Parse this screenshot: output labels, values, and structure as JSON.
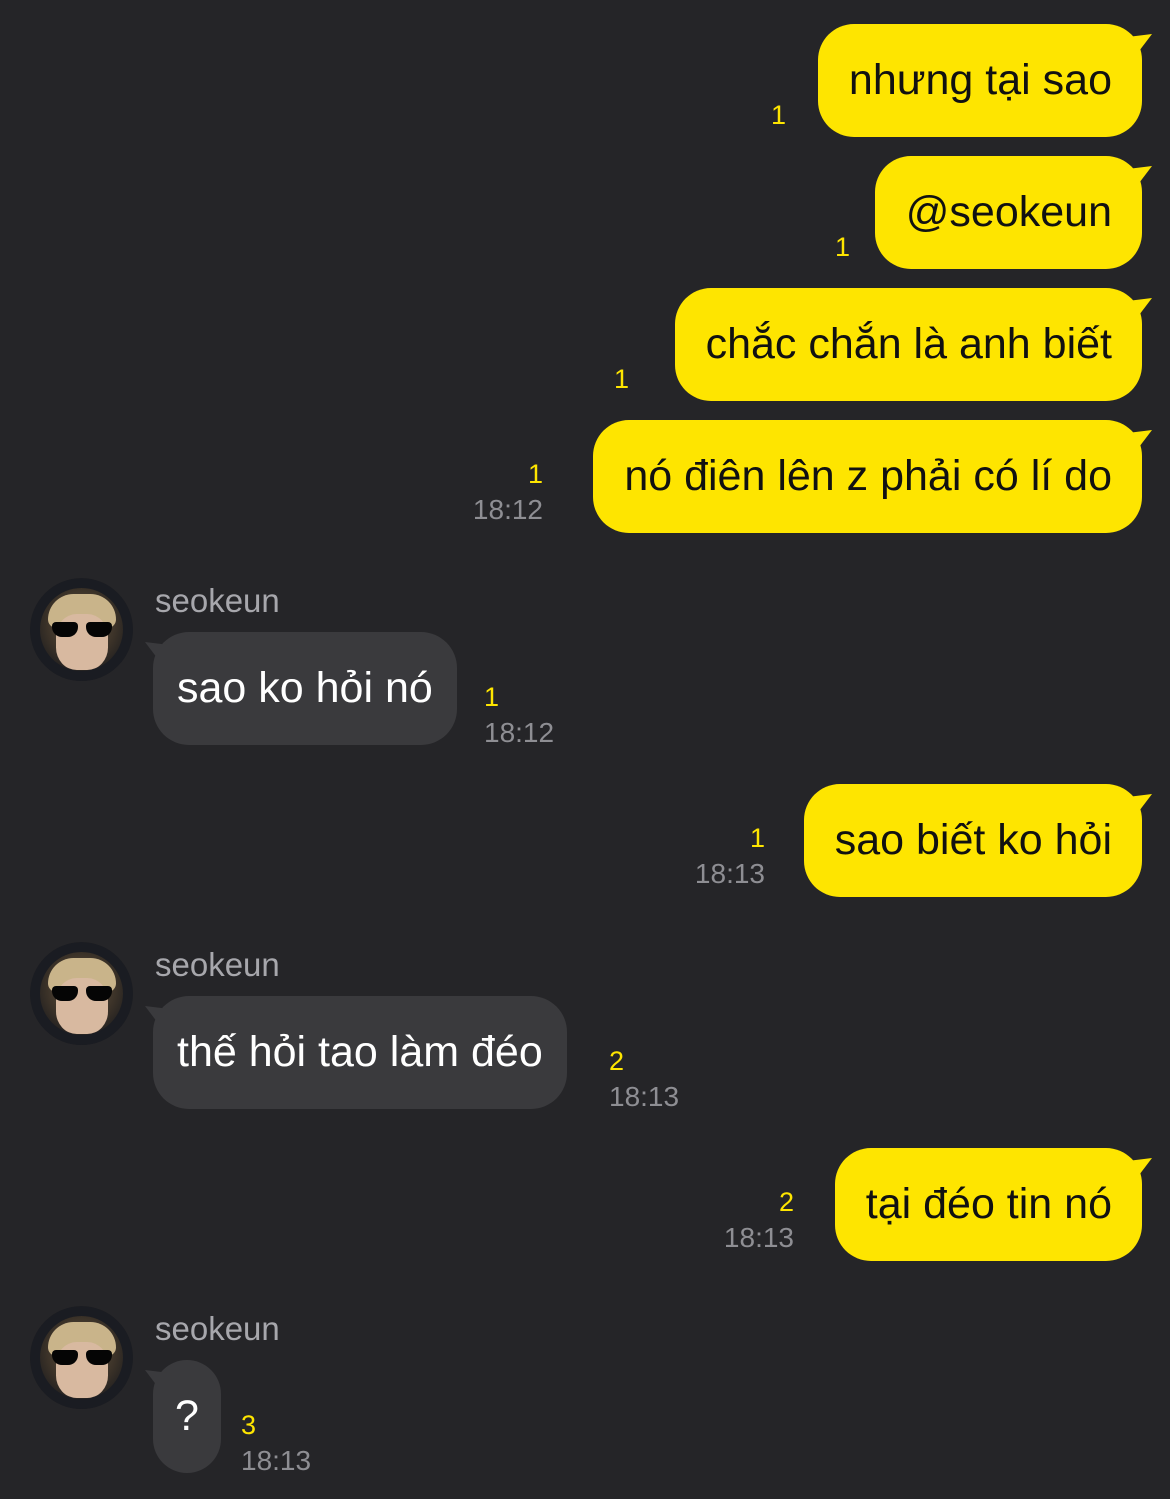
{
  "sender_name": "seokeun",
  "messages": [
    {
      "id": 1,
      "text": "nhưng tại sao",
      "unread": "1",
      "time": ""
    },
    {
      "id": 2,
      "text": "@seokeun",
      "unread": "1",
      "time": ""
    },
    {
      "id": 3,
      "text": "chắc chắn là anh biết",
      "unread": "1",
      "time": ""
    },
    {
      "id": 4,
      "text": "nó điên lên z phải có lí do",
      "unread": "1",
      "time": "18:12"
    },
    {
      "id": 5,
      "text": "sao ko hỏi nó",
      "unread": "1",
      "time": "18:12",
      "sender": "seokeun"
    },
    {
      "id": 6,
      "text": "sao biết ko hỏi",
      "unread": "1",
      "time": "18:13"
    },
    {
      "id": 7,
      "text": "thế hỏi tao làm đéo",
      "unread": "2",
      "time": "18:13",
      "sender": "seokeun"
    },
    {
      "id": 8,
      "text": "tại đéo tin nó",
      "unread": "2",
      "time": "18:13"
    },
    {
      "id": 9,
      "text": "?",
      "unread": "3",
      "time": "18:13",
      "sender": "seokeun"
    }
  ],
  "colors": {
    "background": "#252528",
    "outgoing_bubble": "#fee500",
    "incoming_bubble": "#3a3a3d",
    "unread_count": "#fee500",
    "timestamp": "#8e8e93"
  }
}
